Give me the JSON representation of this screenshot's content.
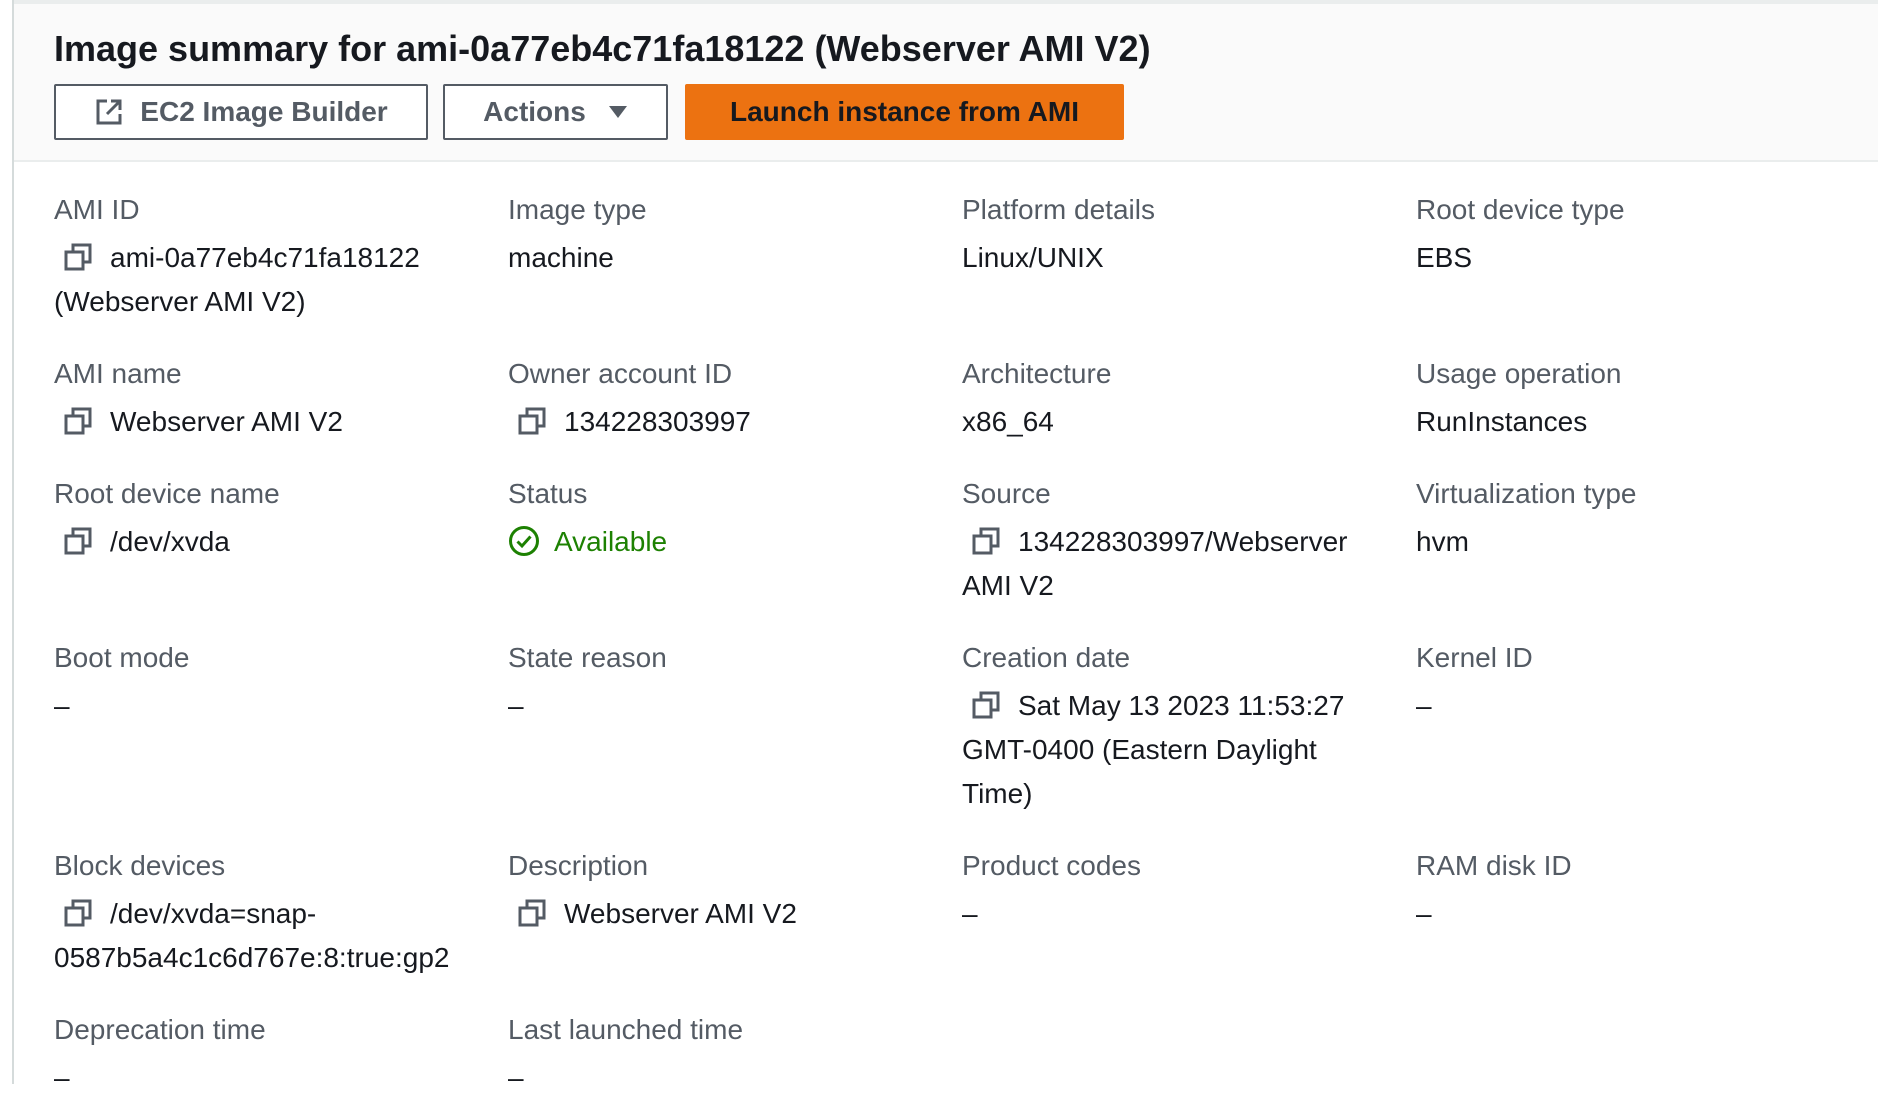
{
  "header": {
    "title": "Image summary for ami-0a77eb4c71fa18122 (Webserver AMI V2)",
    "buttons": {
      "builder": "EC2 Image Builder",
      "actions": "Actions",
      "launch": "Launch instance from AMI"
    }
  },
  "colors": {
    "primary_button": "#ec7211",
    "status_available": "#1d8102",
    "label": "#545b64"
  },
  "fields": {
    "ami_id": {
      "label": "AMI ID",
      "value": "ami-0a77eb4c71fa18122",
      "value2": "(Webserver AMI V2)",
      "icon": "copy-icon"
    },
    "image_type": {
      "label": "Image type",
      "value": "machine"
    },
    "platform_details": {
      "label": "Platform details",
      "value": "Linux/UNIX"
    },
    "root_device_type": {
      "label": "Root device type",
      "value": "EBS"
    },
    "ami_name": {
      "label": "AMI name",
      "value": "Webserver AMI V2",
      "icon": "copy-icon"
    },
    "owner_account_id": {
      "label": "Owner account ID",
      "value": "134228303997",
      "icon": "copy-icon"
    },
    "architecture": {
      "label": "Architecture",
      "value": "x86_64"
    },
    "usage_operation": {
      "label": "Usage operation",
      "value": "RunInstances"
    },
    "root_device_name": {
      "label": "Root device name",
      "value": "/dev/xvda",
      "icon": "copy-icon"
    },
    "status": {
      "label": "Status",
      "value": "Available",
      "icon": "check-circle-icon"
    },
    "source": {
      "label": "Source",
      "value": "134228303997/Webserver",
      "value2": "AMI V2",
      "icon": "copy-icon"
    },
    "virtualization_type": {
      "label": "Virtualization type",
      "value": "hvm"
    },
    "boot_mode": {
      "label": "Boot mode",
      "value": "–"
    },
    "state_reason": {
      "label": "State reason",
      "value": "–"
    },
    "creation_date": {
      "label": "Creation date",
      "value": "Sat May 13 2023 11:53:27",
      "value2": "GMT-0400 (Eastern Daylight",
      "value3": "Time)",
      "icon": "copy-icon"
    },
    "kernel_id": {
      "label": "Kernel ID",
      "value": "–"
    },
    "block_devices": {
      "label": "Block devices",
      "value": "/dev/xvda=snap-",
      "value2": "0587b5a4c1c6d767e:8:true:gp2",
      "icon": "copy-icon"
    },
    "description": {
      "label": "Description",
      "value": "Webserver AMI V2",
      "icon": "copy-icon"
    },
    "product_codes": {
      "label": "Product codes",
      "value": "–"
    },
    "ram_disk_id": {
      "label": "RAM disk ID",
      "value": "–"
    },
    "deprecation_time": {
      "label": "Deprecation time",
      "value": "–"
    },
    "last_launched_time": {
      "label": "Last launched time",
      "value": "–"
    }
  }
}
